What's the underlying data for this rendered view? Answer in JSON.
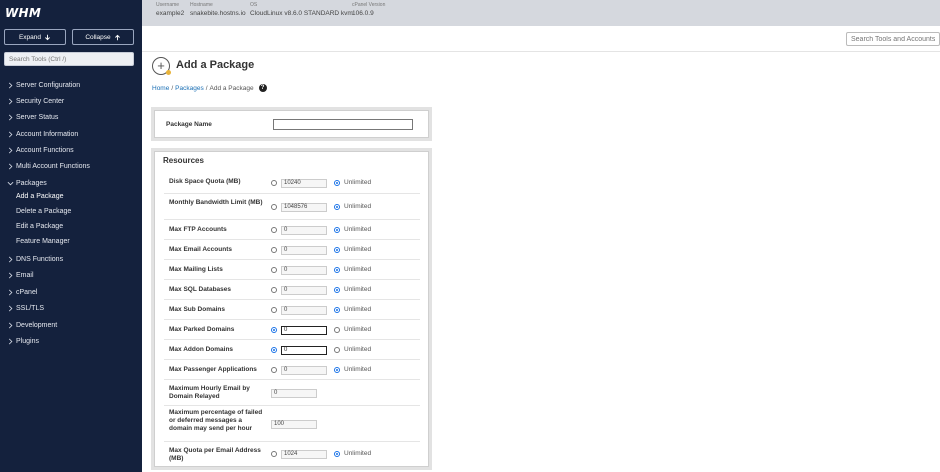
{
  "sidebar": {
    "logo": "WHM",
    "expand_label": "Expand",
    "collapse_label": "Collapse",
    "search_placeholder": "Search Tools (Ctrl /)",
    "items": [
      {
        "label": "Server Configuration"
      },
      {
        "label": "Security Center"
      },
      {
        "label": "Server Status"
      },
      {
        "label": "Account Information"
      },
      {
        "label": "Account Functions"
      },
      {
        "label": "Multi Account Functions"
      },
      {
        "label": "Packages"
      },
      {
        "label": "DNS Functions"
      },
      {
        "label": "Email"
      },
      {
        "label": "cPanel"
      },
      {
        "label": "SSL/TLS"
      },
      {
        "label": "Development"
      },
      {
        "label": "Plugins"
      }
    ],
    "package_subitems": [
      {
        "label": "Add a Package",
        "active": true
      },
      {
        "label": "Delete a Package"
      },
      {
        "label": "Edit a Package"
      },
      {
        "label": "Feature Manager"
      }
    ]
  },
  "topbar": {
    "username_key": "Username",
    "username": "example2",
    "hostname_key": "Hostname",
    "hostname": "snakebite.hostns.io",
    "os_key": "OS",
    "os": "CloudLinux v8.6.0 STANDARD kvm",
    "cpanel_key": "cPanel Version",
    "cpanel": "106.0.9",
    "search_placeholder": "Search Tools and Accounts"
  },
  "page": {
    "title": "Add a Package",
    "breadcrumb": {
      "home": "Home",
      "packages": "Packages",
      "current": "Add a Package",
      "sep": "/"
    }
  },
  "form": {
    "package_name_label": "Package Name",
    "resources_title": "Resources",
    "unlimited_label": "Unlimited",
    "rows": [
      {
        "label": "Disk Space Quota (MB)",
        "value": "10240",
        "unlimited": true
      },
      {
        "label": "Monthly Bandwidth Limit (MB)",
        "value": "1048576",
        "unlimited": true
      },
      {
        "label": "Max FTP Accounts",
        "value": "0",
        "unlimited": true
      },
      {
        "label": "Max Email Accounts",
        "value": "0",
        "unlimited": true
      },
      {
        "label": "Max Mailing Lists",
        "value": "0",
        "unlimited": true
      },
      {
        "label": "Max SQL Databases",
        "value": "0",
        "unlimited": true
      },
      {
        "label": "Max Sub Domains",
        "value": "0",
        "unlimited": true
      },
      {
        "label": "Max Parked Domains",
        "value": "0",
        "unlimited": false
      },
      {
        "label": "Max Addon Domains",
        "value": "0",
        "unlimited": false
      },
      {
        "label": "Max Passenger Applications",
        "value": "0",
        "unlimited": true
      },
      {
        "label": "Maximum Hourly Email by Domain Relayed",
        "value": "0",
        "unlimited": null
      },
      {
        "label": "Maximum percentage of failed or deferred messages a domain may send per hour",
        "value": "100",
        "unlimited": null
      },
      {
        "label": "Max Quota per Email Address (MB)",
        "value": "1024",
        "unlimited": true
      }
    ]
  }
}
